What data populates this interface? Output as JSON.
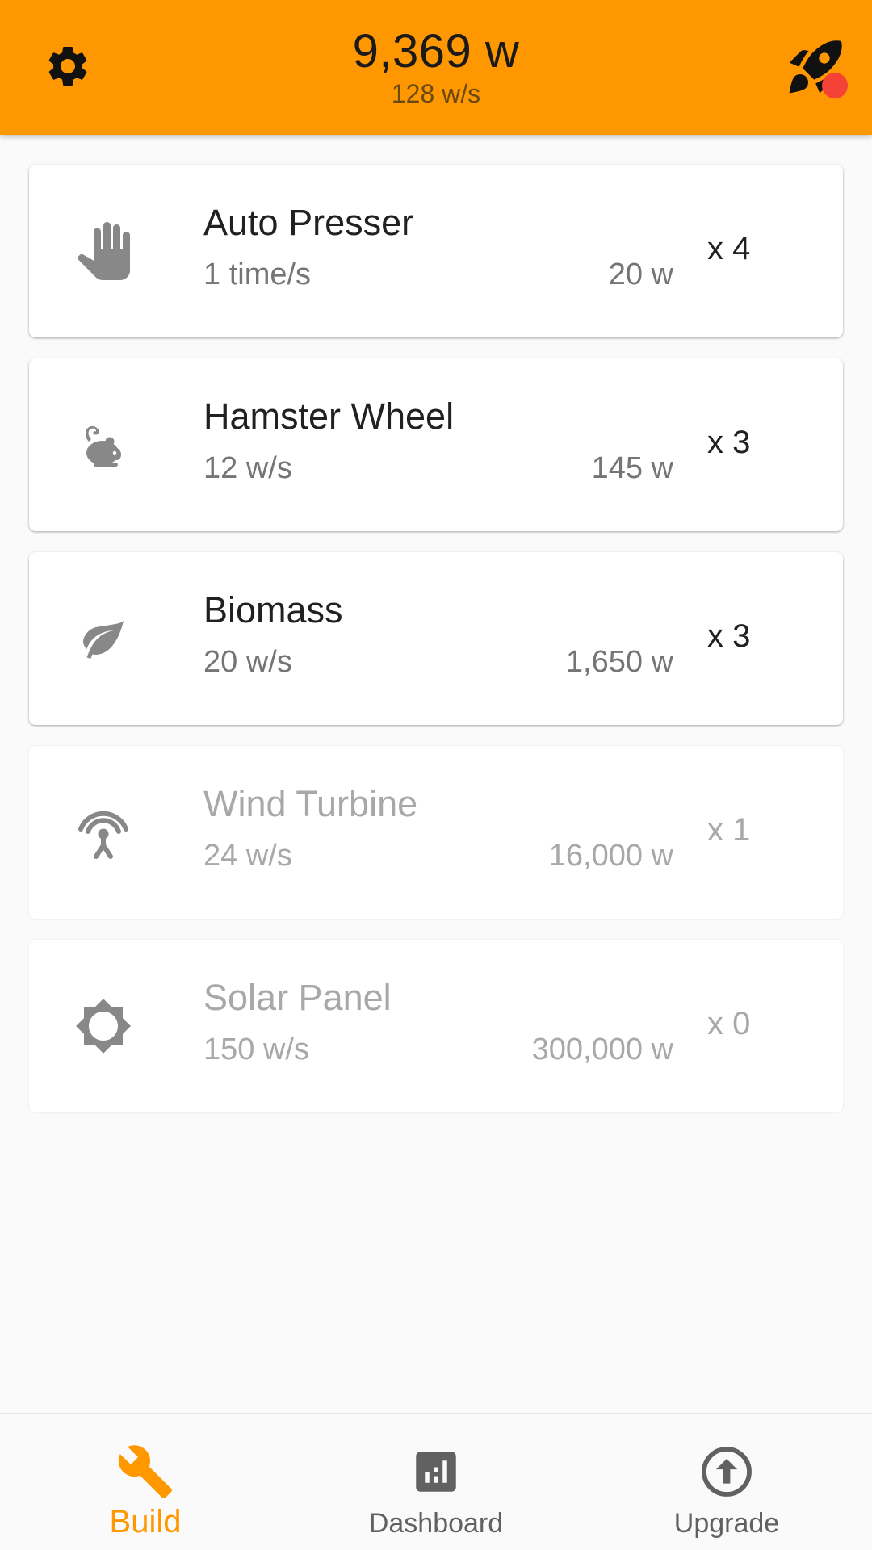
{
  "header": {
    "total_power": "9,369 w",
    "rate": "128 w/s",
    "settings_icon": "gear-icon",
    "rocket_icon": "rocket-icon",
    "notification_color": "#f44336",
    "accent": "#ff9800"
  },
  "items": [
    {
      "name": "Auto Presser",
      "rate": "1 time/s",
      "cost": "20 w",
      "count": "x 4",
      "icon": "hand-icon",
      "enabled": true
    },
    {
      "name": "Hamster Wheel",
      "rate": "12 w/s",
      "cost": "145 w",
      "count": "x 3",
      "icon": "mouse-icon",
      "enabled": true
    },
    {
      "name": "Biomass",
      "rate": "20 w/s",
      "cost": "1,650 w",
      "count": "x 3",
      "icon": "leaf-icon",
      "enabled": true
    },
    {
      "name": "Wind Turbine",
      "rate": "24 w/s",
      "cost": "16,000 w",
      "count": "x 1",
      "icon": "antenna-icon",
      "enabled": false
    },
    {
      "name": "Solar Panel",
      "rate": "150 w/s",
      "cost": "300,000 w",
      "count": "x 0",
      "icon": "sun-icon",
      "enabled": false
    }
  ],
  "nav": {
    "build": {
      "label": "Build",
      "icon": "wrench-icon",
      "active": true
    },
    "dashboard": {
      "label": "Dashboard",
      "icon": "chart-icon",
      "active": false
    },
    "upgrade": {
      "label": "Upgrade",
      "icon": "upgrade-icon",
      "active": false
    }
  }
}
